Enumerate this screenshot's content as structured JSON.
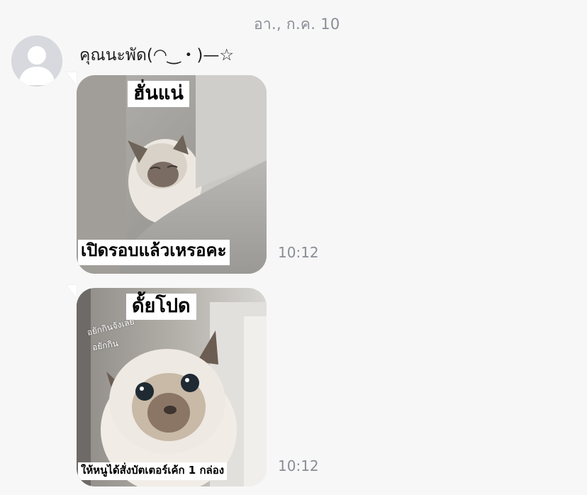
{
  "chat": {
    "date_label": "อา., ก.ค. 10",
    "sender": {
      "name": "คุณนะพัด(⁠◠⁠‿⁠・⁠)⁠—⁠☆",
      "avatar": "default-user-icon"
    },
    "messages": [
      {
        "type": "sticker-image",
        "top_caption": "ฮั่นแน่",
        "bottom_caption": "เปิดรอบแล้วเหรอคะ",
        "time": "10:12"
      },
      {
        "type": "sticker-image",
        "top_caption": "ดั้ยโปด",
        "overlay_text_1": "อยักกินจังเลย",
        "overlay_text_2": "อยักกิน",
        "bottom_caption": "ให้หนูได้สั่งบัตเตอร์เค้ก 1 กล่อง",
        "time": "10:12"
      }
    ]
  },
  "colors": {
    "background": "#f7f7f7",
    "meta_text": "#8a8d96",
    "avatar_bg": "#d7d9de"
  }
}
